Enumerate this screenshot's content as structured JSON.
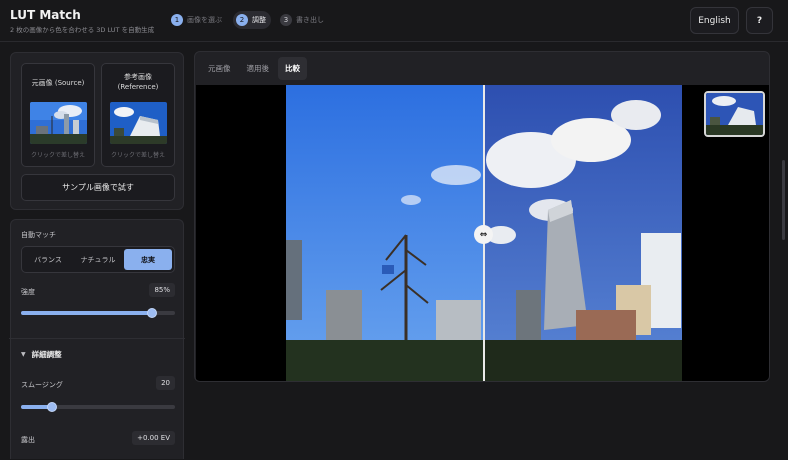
{
  "header": {
    "title": "LUT Match",
    "subtitle": "2 枚の画像から色を合わせる 3D LUT を自動生成",
    "steps": [
      {
        "num": "1",
        "label": "画像を選ぶ"
      },
      {
        "num": "2",
        "label": "調整"
      },
      {
        "num": "3",
        "label": "書き出し"
      }
    ],
    "active_step": 2,
    "language_button": "English",
    "help_button": "?"
  },
  "images_panel": {
    "source": {
      "caption": "元画像 (Source)",
      "hint": "クリックで差し替え"
    },
    "reference": {
      "caption": "参考画像 (Reference)",
      "hint": "クリックで差し替え"
    },
    "sample_button": "サンプル画像で試す"
  },
  "adjust_panel": {
    "auto_match_label": "自動マッチ",
    "modes": [
      "バランス",
      "ナチュラル",
      "忠実"
    ],
    "active_mode": "忠実",
    "strength": {
      "label": "強度",
      "value_text": "85%",
      "value": 0.85
    },
    "details_label": "詳細調整",
    "smoothing": {
      "label": "スムージング",
      "value_text": "20",
      "value": 0.2
    },
    "exposure": {
      "label": "露出",
      "value_text": "+0.00 EV"
    }
  },
  "viewer": {
    "tabs": [
      "元画像",
      "適用後",
      "比較"
    ],
    "active_tab": "比較",
    "split_handle_icon": "⇔",
    "split_position": 0.5
  },
  "colors": {
    "accent": "#8ab0ee",
    "background": "#18181a",
    "panel": "#212125"
  }
}
